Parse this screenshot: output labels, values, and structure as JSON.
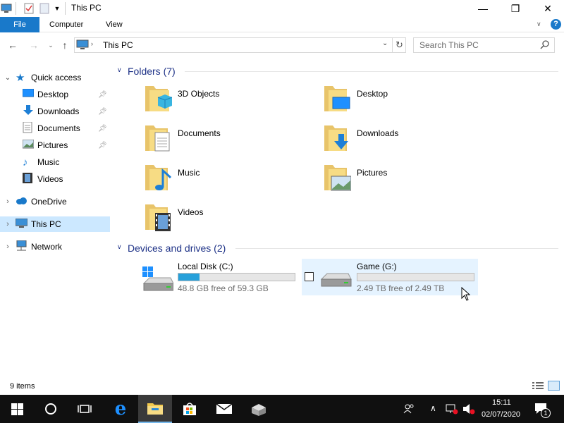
{
  "window": {
    "title": "This PC",
    "minimize_label": "—",
    "maximize_label": "❐",
    "close_label": "✕"
  },
  "ribbon": {
    "tabs": [
      {
        "label": "File"
      },
      {
        "label": "Computer"
      },
      {
        "label": "View"
      }
    ],
    "help_label": "?"
  },
  "nav": {
    "address": "This PC",
    "search_placeholder": "Search This PC"
  },
  "sidebar": {
    "quick_access": "Quick access",
    "items": [
      {
        "label": "Desktop"
      },
      {
        "label": "Downloads"
      },
      {
        "label": "Documents"
      },
      {
        "label": "Pictures"
      },
      {
        "label": "Music"
      },
      {
        "label": "Videos"
      }
    ],
    "onedrive": "OneDrive",
    "this_pc": "This PC",
    "network": "Network"
  },
  "content": {
    "folders_header": "Folders (7)",
    "folders": [
      {
        "label": "3D Objects"
      },
      {
        "label": "Desktop"
      },
      {
        "label": "Documents"
      },
      {
        "label": "Downloads"
      },
      {
        "label": "Music"
      },
      {
        "label": "Pictures"
      },
      {
        "label": "Videos"
      }
    ],
    "devices_header": "Devices and drives (2)",
    "drives": [
      {
        "label": "Local Disk (C:)",
        "free": "48.8 GB free of 59.3 GB",
        "used_fraction": 0.18
      },
      {
        "label": "Game (G:)",
        "free": "2.49 TB free of 2.49 TB",
        "used_fraction": 0.0
      }
    ]
  },
  "status": {
    "items": "9 items"
  },
  "taskbar": {
    "time": "15:11",
    "date": "02/07/2020",
    "notification_count": "1"
  },
  "colors": {
    "accent": "#1979ca",
    "selection": "#cce8ff",
    "header_text": "#1e3287",
    "bar_fill": "#26a0da",
    "taskbar": "#101010"
  }
}
